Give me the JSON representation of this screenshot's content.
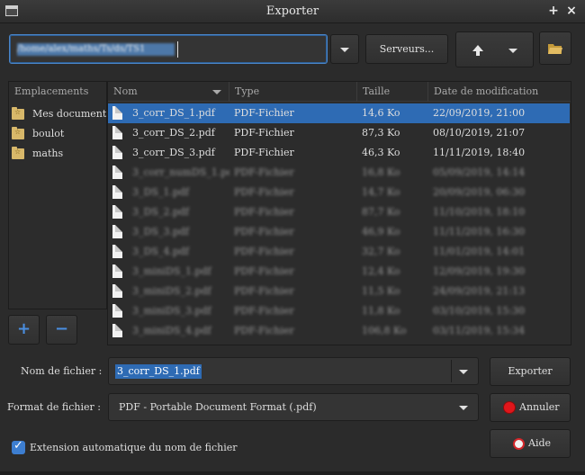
{
  "window": {
    "title": "Exporter",
    "pin_glyph": "+",
    "close_glyph": "×"
  },
  "path_bar": {
    "value": "/home/alex/maths/Ts/ds/TS1",
    "servers_label": "Serveurs..."
  },
  "places": {
    "header": "Emplacements",
    "items": [
      {
        "label": "Mes document",
        "icon": "folder-star-icon"
      },
      {
        "label": "boulot",
        "icon": "folder-star-icon"
      },
      {
        "label": "maths",
        "icon": "folder-star-icon"
      }
    ],
    "add_label": "+",
    "remove_label": "−"
  },
  "files": {
    "columns": [
      "Nom",
      "Type",
      "Taille",
      "Date de modification"
    ],
    "rows": [
      {
        "name": "3_corr_DS_1.pdf",
        "type": "PDF-Fichier",
        "size": "14,6 Ko",
        "date": "22/09/2019, 21:00",
        "selected": true,
        "blurred": false
      },
      {
        "name": "3_corr_DS_2.pdf",
        "type": "PDF-Fichier",
        "size": "87,3 Ko",
        "date": "08/10/2019, 21:07",
        "selected": false,
        "blurred": false
      },
      {
        "name": "3_corr_DS_3.pdf",
        "type": "PDF-Fichier",
        "size": "46,3 Ko",
        "date": "11/11/2019, 18:40",
        "selected": false,
        "blurred": false
      },
      {
        "name": "3_corr_numDS_1.pdf",
        "type": "PDF-Fichier",
        "size": "16,8 Ko",
        "date": "05/09/2019, 14:14",
        "selected": false,
        "blurred": true
      },
      {
        "name": "3_DS_1.pdf",
        "type": "PDF-Fichier",
        "size": "14,7 Ko",
        "date": "20/09/2019, 06:30",
        "selected": false,
        "blurred": true
      },
      {
        "name": "3_DS_2.pdf",
        "type": "PDF-Fichier",
        "size": "87,7 Ko",
        "date": "11/10/2019, 18:10",
        "selected": false,
        "blurred": true
      },
      {
        "name": "3_DS_3.pdf",
        "type": "PDF-Fichier",
        "size": "46,9 Ko",
        "date": "11/11/2019, 16:30",
        "selected": false,
        "blurred": true
      },
      {
        "name": "3_DS_4.pdf",
        "type": "PDF-Fichier",
        "size": "32,7 Ko",
        "date": "11/01/2019, 14:01",
        "selected": false,
        "blurred": true
      },
      {
        "name": "3_miniDS_1.pdf",
        "type": "PDF-Fichier",
        "size": "12,4 Ko",
        "date": "12/09/2019, 19:30",
        "selected": false,
        "blurred": true
      },
      {
        "name": "3_miniDS_2.pdf",
        "type": "PDF-Fichier",
        "size": "11,5 Ko",
        "date": "24/09/2019, 21:13",
        "selected": false,
        "blurred": true
      },
      {
        "name": "3_miniDS_3.pdf",
        "type": "PDF-Fichier",
        "size": "11,8 Ko",
        "date": "03/10/2019, 15:30",
        "selected": false,
        "blurred": true
      },
      {
        "name": "3_miniDS_4.pdf",
        "type": "PDF-Fichier",
        "size": "106,8 Ko",
        "date": "03/11/2019, 15:34",
        "selected": false,
        "blurred": true
      }
    ]
  },
  "form": {
    "filename_label": "Nom de fichier :",
    "filename_value": "3_corr_DS_1.pdf",
    "format_label": "Format de fichier :",
    "format_value": "PDF - Portable Document Format (.pdf)",
    "auto_ext_label": "Extension automatique du nom de fichier",
    "auto_ext_checked": true,
    "export_label": "Exporter",
    "cancel_label": "Annuler",
    "help_label": "Aide"
  },
  "colors": {
    "selection": "#2e6bb4",
    "accent": "#4a85c8",
    "cancel_red": "#e0161b"
  }
}
